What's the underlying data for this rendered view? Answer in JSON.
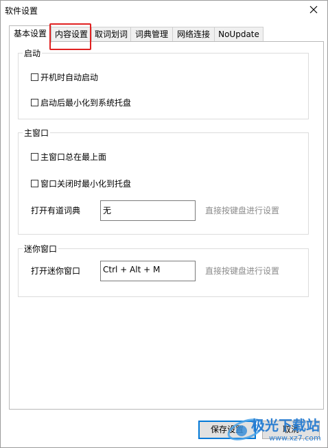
{
  "window": {
    "title": "软件设置"
  },
  "tabs": [
    {
      "label": "基本设置",
      "active": true
    },
    {
      "label": "内容设置",
      "active": false,
      "highlighted": true
    },
    {
      "label": "取词划词",
      "active": false
    },
    {
      "label": "词典管理",
      "active": false
    },
    {
      "label": "网络连接",
      "active": false
    },
    {
      "label": "NoUpdate",
      "active": false
    }
  ],
  "groups": {
    "startup": {
      "title": "启动",
      "options": [
        {
          "label": "开机时自动启动",
          "checked": false
        },
        {
          "label": "启动后最小化到系统托盘",
          "checked": false
        }
      ]
    },
    "main_window": {
      "title": "主窗口",
      "options": [
        {
          "label": "主窗口总在最上面",
          "checked": false
        },
        {
          "label": "窗口关闭时最小化到托盘",
          "checked": false
        }
      ],
      "hotkey_label": "打开有道词典",
      "hotkey_value": "无",
      "hotkey_hint": "直接按键盘进行设置"
    },
    "mini_window": {
      "title": "迷你窗口",
      "hotkey_label": "打开迷你窗口",
      "hotkey_value": "Ctrl + Alt + M",
      "hotkey_hint": "直接按键盘进行设置"
    }
  },
  "buttons": {
    "save": "保存设置",
    "cancel": "取消"
  },
  "watermark": {
    "brand": "极光下载站",
    "url": "www.xz7.com"
  },
  "colors": {
    "highlight": "#e02020",
    "accent": "#0078d7",
    "hint": "#8c8c8c"
  }
}
